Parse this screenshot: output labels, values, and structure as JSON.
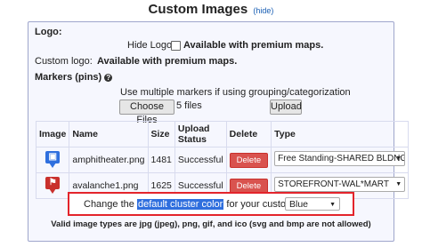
{
  "header": {
    "title": "Custom Images",
    "hide_link": "(hide)"
  },
  "logo": {
    "section_label": "Logo:",
    "hide_logo_label": "Hide Logo",
    "hide_logo_premium": "Available with premium maps.",
    "custom_logo_label": "Custom logo:",
    "custom_logo_premium": "Available with premium maps."
  },
  "markers": {
    "section_label": "Markers (pins)",
    "instruction": "Use multiple markers if using grouping/categorization",
    "choose_files_label": "Choose Files",
    "files_count": "5 files",
    "upload_label": "Upload",
    "columns": [
      "Image",
      "Name",
      "Size",
      "Upload Status",
      "Delete",
      "Type"
    ],
    "rows": [
      {
        "icon": "building-pin-icon",
        "icon_color": "#2f6fde",
        "name": "amphitheater.png",
        "size": "1481",
        "status": "Successful",
        "delete_label": "Delete",
        "type": "Free Standing-SHARED BLDNG"
      },
      {
        "icon": "store-pin-icon",
        "icon_color": "#c9302c",
        "name": "avalanche1.png",
        "size": "1625",
        "status": "Successful",
        "delete_label": "Delete",
        "type": "STOREFRONT-WAL*MART"
      }
    ]
  },
  "cluster": {
    "prefix": "Change the",
    "link": "default cluster color",
    "suffix": "for your custom markers:",
    "selected_color": "Blue"
  },
  "footer_note": "Valid image types are jpg (jpeg), png, gif, and ico (svg and bmp are not allowed)",
  "colors": {
    "panel_bg": "#f6f7fe",
    "panel_border": "#9fa6cc",
    "delete_red": "#d9534f",
    "highlight_border": "#e3242b",
    "selection_blue": "#2f6fde"
  }
}
